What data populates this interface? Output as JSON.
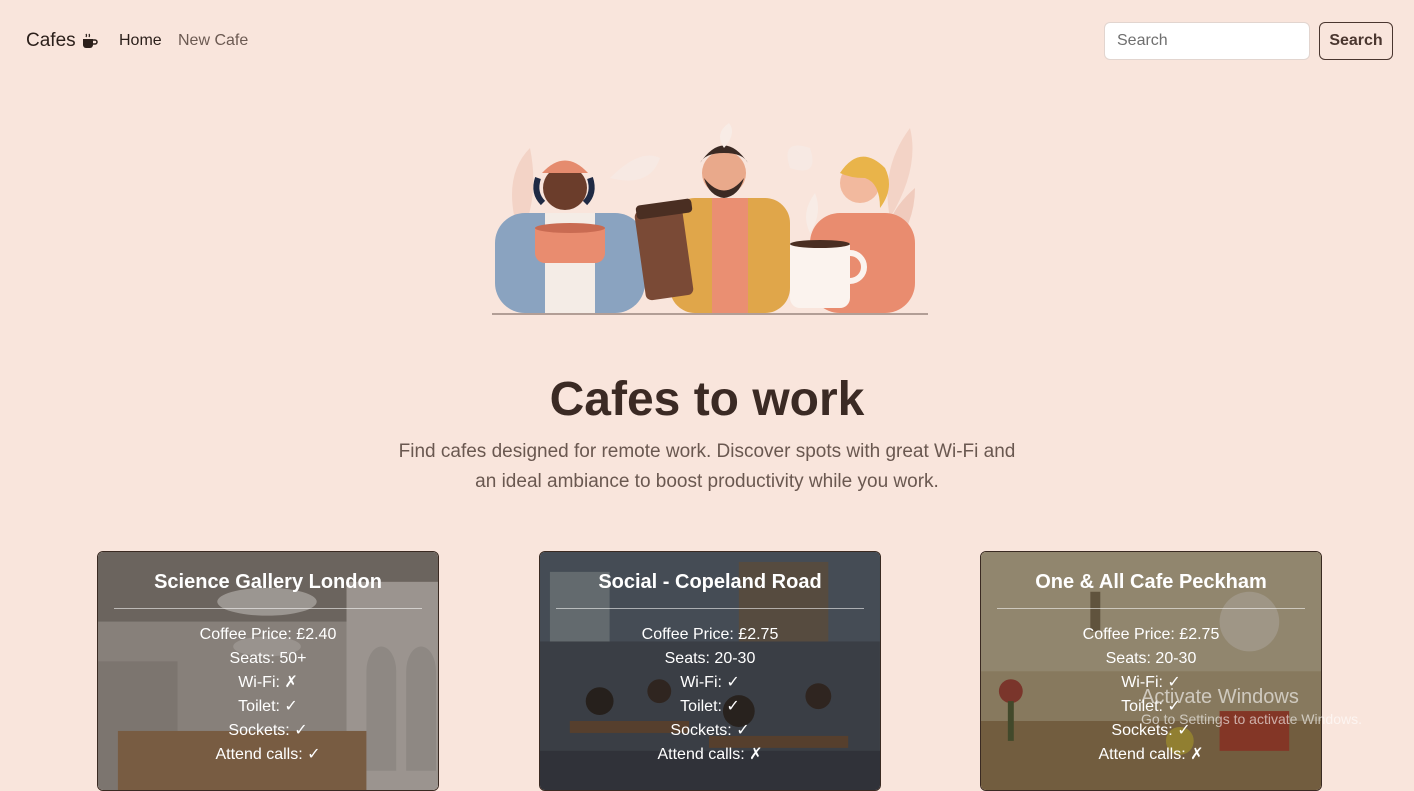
{
  "navbar": {
    "brand": "Cafes",
    "brand_icon": "coffee-cup-icon",
    "links": [
      "Home",
      "New Cafe"
    ],
    "search_placeholder": "Search",
    "search_button": "Search"
  },
  "hero": {
    "title": "Cafes to work",
    "subtitle": "Find cafes designed for remote work. Discover spots with great Wi-Fi and an ideal ambiance to boost productivity while you work."
  },
  "cafes": [
    {
      "name": "Science Gallery London",
      "coffee_price": "Coffee Price: £2.40",
      "seats": "Seats: 50+",
      "wifi": "Wi-Fi: ✗",
      "toilet": "Toilet: ✓",
      "sockets": "Sockets: ✓",
      "calls": "Attend calls: ✓"
    },
    {
      "name": "Social - Copeland Road",
      "coffee_price": "Coffee Price: £2.75",
      "seats": "Seats: 20-30",
      "wifi": "Wi-Fi: ✓",
      "toilet": "Toilet: ✓",
      "sockets": "Sockets: ✓",
      "calls": "Attend calls: ✗"
    },
    {
      "name": "One & All Cafe Peckham",
      "coffee_price": "Coffee Price: £2.75",
      "seats": "Seats: 20-30",
      "wifi": "Wi-Fi: ✓",
      "toilet": "Toilet: ✓",
      "sockets": "Sockets: ✓",
      "calls": "Attend calls: ✗"
    }
  ],
  "os_overlay": {
    "title": "Activate Windows",
    "subtitle": "Go to Settings to activate Windows."
  },
  "colors": {
    "background": "#f9e5dc",
    "text_dark": "#3b2a24",
    "accent_brown": "#4a362f"
  }
}
